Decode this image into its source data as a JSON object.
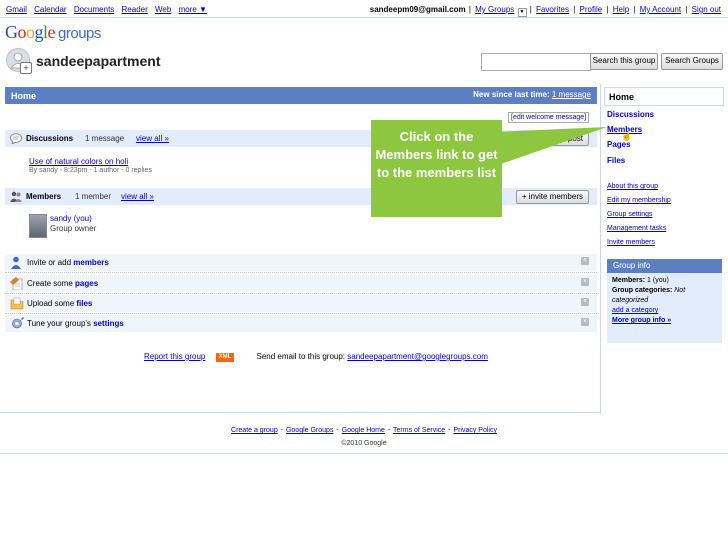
{
  "topbar": {
    "apps": [
      "Gmail",
      "Calendar",
      "Documents",
      "Reader",
      "Web",
      "more ▼"
    ],
    "email": "sandeepm09@gmail.com",
    "my_groups": "My Groups",
    "favorites": "Favorites",
    "profile": "Profile",
    "help": "Help",
    "my_account": "My Account",
    "sign_out": "Sign out",
    "separator": "|"
  },
  "logo": {
    "letters": [
      "G",
      "o",
      "o",
      "g",
      "l",
      "e"
    ],
    "suffix": "groups"
  },
  "group": {
    "name": "sandeepapartment"
  },
  "search": {
    "placeholder": "",
    "search_this_group": "Search this group",
    "search_groups": "Search Groups"
  },
  "home_bar": {
    "title": "Home",
    "new_since_label": "New since last time:",
    "new_since_value": "1 message"
  },
  "edit_welcome": "[edit welcome message]",
  "discussions": {
    "title": "Discussions",
    "count": "1 message",
    "view_all": "view all »",
    "new_post": "+ new post",
    "items": [
      {
        "title": "Use of natural colors on holi",
        "meta": "By sandy - 8:23pm - 1 author - 0 replies"
      }
    ]
  },
  "members": {
    "title": "Members",
    "count": "1 member",
    "view_all": "view all »",
    "invite": "+ invite members",
    "items": [
      {
        "name": "sandy (you)",
        "role": "Group owner"
      }
    ]
  },
  "tasks": [
    {
      "prefix": "Invite or add ",
      "bold": "members",
      "icon": "person-add-icon"
    },
    {
      "prefix": "Create some ",
      "bold": "pages",
      "icon": "pages-icon"
    },
    {
      "prefix": "Upload some ",
      "bold": "files",
      "icon": "folder-icon"
    },
    {
      "prefix": "Tune your group's ",
      "bold": "settings",
      "icon": "settings-icon"
    }
  ],
  "close_glyph": "×",
  "footer": {
    "report": "Report this group",
    "xml": "XML",
    "send_email": "Send email to this group:",
    "group_email": "sandeepapartment@googlegroups.com",
    "links": [
      "Create a group",
      "Google Groups",
      "Google Home",
      "Terms of Service",
      "Privacy Policy"
    ],
    "link_sep": "-",
    "copyright": "©2010 Google"
  },
  "sidebar": {
    "home": "Home",
    "nav": [
      "Discussions",
      "Members",
      "Pages",
      "Files"
    ],
    "manage": [
      "About this group",
      "Edit my membership",
      "Group settings",
      "Management tasks",
      "Invite members"
    ],
    "group_info": {
      "title": "Group info",
      "members_label": "Members:",
      "members_value": "1 (you)",
      "categories_label": "Group categories:",
      "categories_value": "Not categorized",
      "add_category": "add a category",
      "more_info": "More group info »"
    }
  },
  "callout": {
    "text": "Click on the Members link to get to the members list",
    "color": "#8dc63f"
  },
  "colors": {
    "bar_blue": "#5c7fc4",
    "section_bg": "#e3ecfb",
    "link": "#0000cc"
  }
}
